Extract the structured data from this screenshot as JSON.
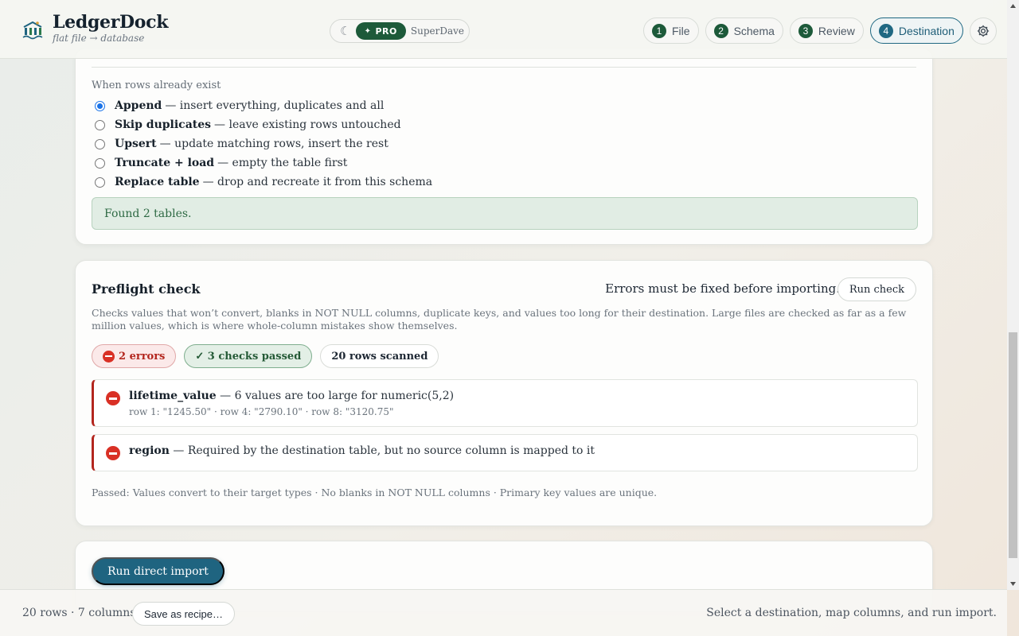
{
  "brand": {
    "name": "LedgerDock",
    "tagline": "flat file → database"
  },
  "mode": {
    "moon_glyph": "☾",
    "pro_label": "PRO",
    "pro_glyph": "✦",
    "user": "SuperDave"
  },
  "steps": [
    {
      "num": "1",
      "label": "File",
      "active": false
    },
    {
      "num": "2",
      "label": "Schema",
      "active": false
    },
    {
      "num": "3",
      "label": "Review",
      "active": false
    },
    {
      "num": "4",
      "label": "Destination",
      "active": true
    }
  ],
  "existing_rows": {
    "label": "When rows already exist",
    "options": [
      {
        "title": "Append",
        "desc": "— insert everything, duplicates and all",
        "checked": true
      },
      {
        "title": "Skip duplicates",
        "desc": "— leave existing rows untouched",
        "checked": false
      },
      {
        "title": "Upsert",
        "desc": "— update matching rows, insert the rest",
        "checked": false
      },
      {
        "title": "Truncate + load",
        "desc": "— empty the table first",
        "checked": false
      },
      {
        "title": "Replace table",
        "desc": "— drop and recreate it from this schema",
        "checked": false
      }
    ],
    "status": "Found 2 tables."
  },
  "preflight": {
    "title": "Preflight check",
    "warning": "Errors must be fixed before importing.",
    "run_label": "Run check",
    "description": "Checks values that won’t convert, blanks in NOT NULL columns, duplicate keys, and values too long for their destination. Large files are checked as far as a few million values, which is where whole-column mistakes show themselves.",
    "chips": {
      "errors": "2 errors",
      "passed": "✓ 3 checks passed",
      "scanned": "20 rows scanned"
    },
    "issues": [
      {
        "column": "lifetime_value",
        "message": "— 6 values are too large for numeric(5,2)",
        "detail": "row 1: \"1245.50\" · row 4: \"2790.10\" · row 8: \"3120.75\""
      },
      {
        "column": "region",
        "message": "— Required by the destination table, but no source column is mapped to it",
        "detail": ""
      }
    ],
    "passed_text": "Passed: Values convert to their target types · No blanks in NOT NULL columns · Primary key values are unique."
  },
  "import": {
    "label": "Run direct import"
  },
  "footer": {
    "stats": "20 rows · 7 columns",
    "save_label": "Save as recipe…",
    "hint": "Select a destination, map columns, and run import."
  },
  "colors": {
    "accent": "#1f6480",
    "brand_green": "#1d5a3a",
    "error": "#d93025",
    "success_bg": "#e1ede4"
  }
}
